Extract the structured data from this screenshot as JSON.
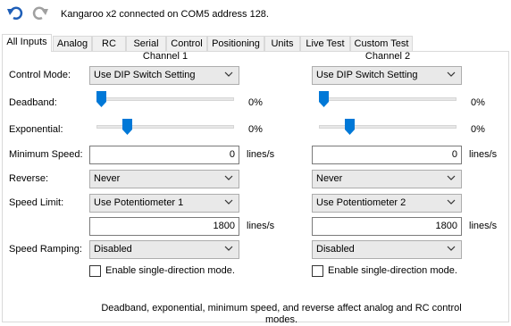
{
  "toolbar": {
    "undo_icon": "undo-icon",
    "redo_icon": "redo-icon",
    "status": "Kangaroo x2 connected on COM5 address 128."
  },
  "tabs": [
    {
      "label": "All Inputs",
      "active": true
    },
    {
      "label": "Analog"
    },
    {
      "label": "RC"
    },
    {
      "label": "Serial"
    },
    {
      "label": "Control"
    },
    {
      "label": "Positioning"
    },
    {
      "label": "Units"
    },
    {
      "label": "Live Test"
    },
    {
      "label": "Custom Test"
    }
  ],
  "labels": {
    "control_mode": "Control Mode:",
    "deadband": "Deadband:",
    "exponential": "Exponential:",
    "minimum_speed": "Minimum Speed:",
    "reverse": "Reverse:",
    "speed_limit": "Speed Limit:",
    "speed_ramping": "Speed Ramping:"
  },
  "units": {
    "lines_per_s": "lines/s"
  },
  "channel1": {
    "title": "Channel 1",
    "control_mode": "Use DIP Switch Setting",
    "deadband_pct": "0%",
    "deadband_level": 0,
    "exponential_pct": "0%",
    "exponential_level": 0,
    "minimum_speed": "0",
    "reverse": "Never",
    "speed_limit": "Use Potentiometer 1",
    "speed_limit_value": "1800",
    "speed_ramping": "Disabled",
    "single_direction_label": "Enable single-direction mode.",
    "single_direction_checked": false
  },
  "channel2": {
    "title": "Channel 2",
    "control_mode": "Use DIP Switch Setting",
    "deadband_pct": "0%",
    "deadband_level": 0,
    "exponential_pct": "0%",
    "exponential_level": 0,
    "minimum_speed": "0",
    "reverse": "Never",
    "speed_limit": "Use Potentiometer 2",
    "speed_limit_value": "1800",
    "speed_ramping": "Disabled",
    "single_direction_label": "Enable single-direction mode.",
    "single_direction_checked": false
  },
  "footnote": "Deadband, exponential, minimum speed, and reverse affect analog and RC control modes.",
  "colors": {
    "accent": "#0078d7",
    "icon_blue": "#1f5fb8",
    "icon_grey": "#a0a0a0"
  }
}
